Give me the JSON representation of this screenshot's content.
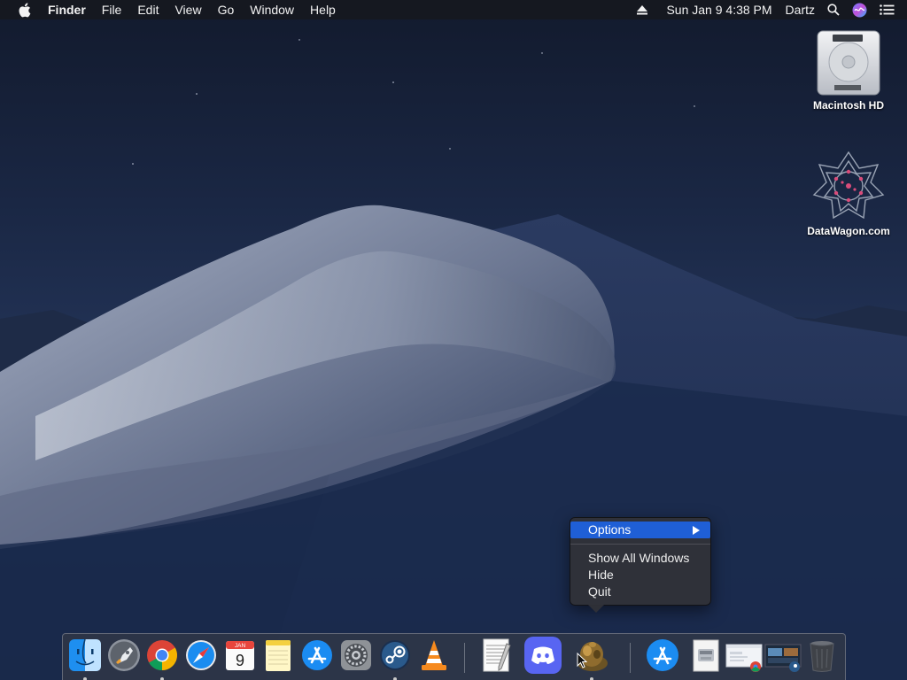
{
  "menubar": {
    "app_name": "Finder",
    "menus": [
      "File",
      "Edit",
      "View",
      "Go",
      "Window",
      "Help"
    ],
    "datetime": "Sun Jan 9  4:38 PM",
    "user": "Dartz"
  },
  "desktop_icons": [
    {
      "label": "Macintosh HD",
      "icon": "hard-drive-icon"
    },
    {
      "label": "DataWagon.com",
      "icon": "datawagon-logo-icon"
    }
  ],
  "context_menu": {
    "items": [
      {
        "label": "Options",
        "has_submenu": true,
        "highlighted": true
      },
      {
        "label": "Show All Windows"
      },
      {
        "label": "Hide"
      },
      {
        "label": "Quit"
      }
    ]
  },
  "dock": {
    "calendar_month": "JAN",
    "calendar_day": "9",
    "items": [
      {
        "name": "Finder",
        "icon": "finder-icon",
        "running": true
      },
      {
        "name": "Launchpad",
        "icon": "launchpad-icon",
        "running": false
      },
      {
        "name": "Google Chrome",
        "icon": "chrome-icon",
        "running": true
      },
      {
        "name": "Safari",
        "icon": "safari-icon",
        "running": false
      },
      {
        "name": "Calendar",
        "icon": "calendar-icon",
        "running": false
      },
      {
        "name": "Notes",
        "icon": "notes-icon",
        "running": false
      },
      {
        "name": "App Store",
        "icon": "app-store-icon",
        "running": false
      },
      {
        "name": "System Preferences",
        "icon": "system-preferences-icon",
        "running": false
      },
      {
        "name": "Steam",
        "icon": "steam-icon",
        "running": true
      },
      {
        "name": "VLC",
        "icon": "vlc-icon",
        "running": false
      },
      {
        "name": "TextEdit",
        "icon": "textedit-icon",
        "running": false
      },
      {
        "name": "Discord",
        "icon": "discord-icon",
        "running": false
      },
      {
        "name": "Game",
        "icon": "game-app-icon",
        "running": true
      },
      {
        "name": "App Store Downloads",
        "icon": "downloads-app-store-icon",
        "running": false
      },
      {
        "name": "Documents",
        "icon": "documents-stack-icon",
        "running": false
      },
      {
        "name": "Chrome Window",
        "icon": "chrome-window-icon",
        "running": false
      },
      {
        "name": "Steam Window",
        "icon": "steam-window-icon",
        "running": false
      },
      {
        "name": "Trash",
        "icon": "trash-icon",
        "running": false
      }
    ]
  },
  "colors": {
    "menu_highlight": "#1f5fd6",
    "sky": "#1a2744",
    "dune": "#8d97ad"
  }
}
